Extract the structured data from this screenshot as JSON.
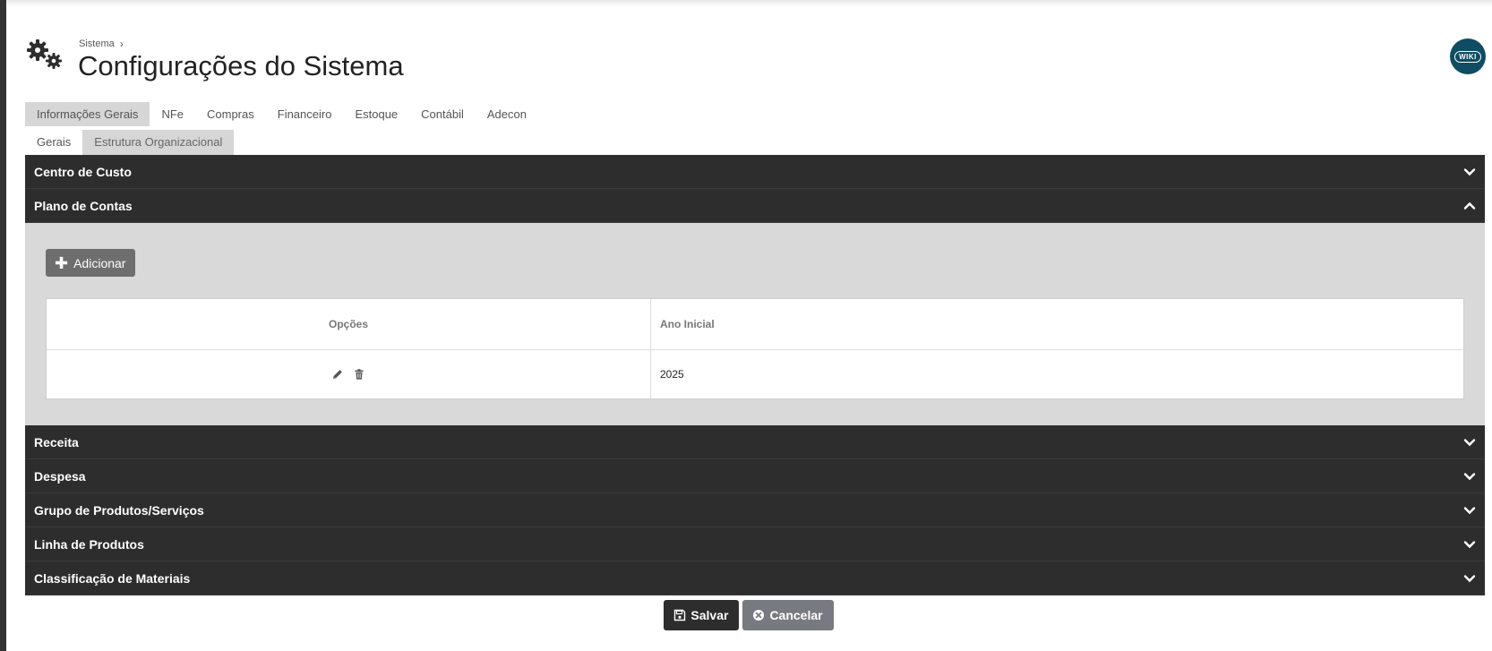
{
  "breadcrumb": {
    "parent": "Sistema"
  },
  "page_title": "Configurações do Sistema",
  "wiki_label": "WIKI",
  "tabs_main": [
    {
      "label": "Informações Gerais",
      "active": true
    },
    {
      "label": "NFe",
      "active": false
    },
    {
      "label": "Compras",
      "active": false
    },
    {
      "label": "Financeiro",
      "active": false
    },
    {
      "label": "Estoque",
      "active": false
    },
    {
      "label": "Contábil",
      "active": false
    },
    {
      "label": "Adecon",
      "active": false
    }
  ],
  "tabs_sub": [
    {
      "label": "Gerais",
      "active": false
    },
    {
      "label": "Estrutura Organizacional",
      "active": true
    }
  ],
  "sections": [
    {
      "label": "Centro de Custo",
      "expanded": false
    },
    {
      "label": "Plano de Contas",
      "expanded": true
    },
    {
      "label": "Receita",
      "expanded": false
    },
    {
      "label": "Despesa",
      "expanded": false
    },
    {
      "label": "Grupo de Produtos/Serviços",
      "expanded": false
    },
    {
      "label": "Linha de Produtos",
      "expanded": false
    },
    {
      "label": "Classificação de Materiais",
      "expanded": false
    }
  ],
  "plano_de_contas": {
    "add_label": "Adicionar",
    "columns": [
      "Opções",
      "Ano Inicial"
    ],
    "rows": [
      {
        "ano_inicial": "2025"
      }
    ]
  },
  "footer": {
    "save_label": "Salvar",
    "cancel_label": "Cancelar"
  },
  "colors": {
    "dark": "#2d2d2d",
    "panel": "#d9d9d9",
    "accent": "#0e4d63"
  }
}
